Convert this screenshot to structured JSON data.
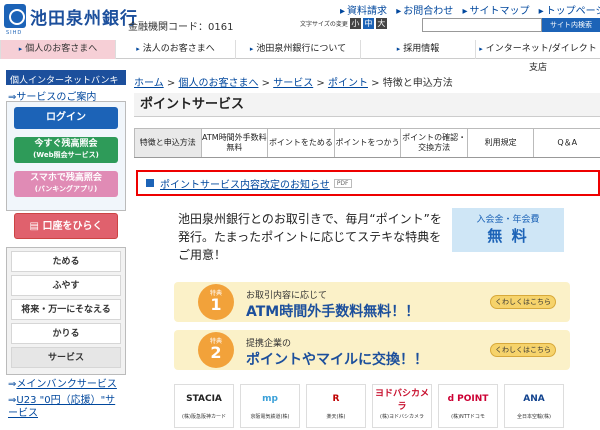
{
  "header": {
    "logo": "池田泉州銀行",
    "logo_sub": "SIHD",
    "bank_code": "金融機関コード：0161",
    "top_links": [
      "資料請求",
      "お問合わせ",
      "サイトマップ",
      "トップページ"
    ],
    "font_size_label": "文字サイズの変更",
    "font_sizes": [
      "小",
      "中",
      "大"
    ],
    "font_size_colors": [
      "#444444",
      "#1c63b7",
      "#444444"
    ],
    "search_placeholder": "",
    "search_button": "サイト内検索"
  },
  "gnav": [
    {
      "label": "個人のお客さまへ",
      "active": true
    },
    {
      "label": "法人のお客さまへ",
      "active": false
    },
    {
      "label": "池田泉州銀行について",
      "active": false
    },
    {
      "label": "採用情報",
      "active": false
    },
    {
      "label": "インターネット/ダイレクト支店",
      "active": false
    }
  ],
  "sidebar": {
    "head": "個人インターネットバンキング",
    "guide_link": "サービスのご案内",
    "login": "ログイン",
    "balance_l1": "今すぐ残高照会",
    "balance_l2": "(Web照会サービス)",
    "app_l1": "スマホで残高照会",
    "app_l2": "(バンキングアプリ)",
    "open_account": "口座をひらく",
    "menu": [
      "ためる",
      "ふやす",
      "将来・万一にそなえる",
      "かりる",
      "サービス"
    ],
    "sub_links": [
      "メインバンクサービス",
      "U23 \"0円（応援）\"サービス"
    ]
  },
  "breadcrumb": [
    "ホーム",
    "個人のお客さまへ",
    "サービス",
    "ポイント",
    "特徴と申込方法"
  ],
  "page_title": "ポイントサービス",
  "tabs": [
    "特徴と申込方法",
    "ATM時間外手数料無料",
    "ポイントをためる",
    "ポイントをつかう",
    "ポイントの確認・交換方法",
    "利用規定",
    "Q＆A"
  ],
  "notice": {
    "text": "ポイントサービス内容改定のお知らせ",
    "badge": "PDF"
  },
  "intro": "池田泉州銀行とのお取引きで、毎月“ポイント”を発行。たまったポイントに応じてステキな特典をご用意！",
  "free_badge": {
    "line1": "入会金・年会費",
    "line2": "無 料"
  },
  "benefits": [
    {
      "tag": "特典",
      "num": "1",
      "line1": "お取引内容に応じて",
      "line2": "ATM時間外手数料無料！！",
      "more": "くわしくはこちら"
    },
    {
      "tag": "特典",
      "num": "2",
      "line1": "提携企業の",
      "line2": "ポイントやマイルに交換！！",
      "more": "くわしくはこちら"
    }
  ],
  "partners": [
    {
      "logo": "STACIA",
      "caption": "(株)阪急阪神カード",
      "color": "#222222"
    },
    {
      "logo": "mp",
      "caption": "京阪電気鉄道(株)",
      "color": "#3aa0d8"
    },
    {
      "logo": "R",
      "caption": "楽天(株)",
      "color": "#bf0000"
    },
    {
      "logo": "ヨドバシカメラ",
      "caption": "(株)ヨドバシカメラ",
      "color": "#c8102e"
    },
    {
      "logo": "d POINT",
      "caption": "(株)NTTドコモ",
      "color": "#cc0033"
    },
    {
      "logo": "ANA",
      "caption": "全日本空輸(株)",
      "color": "#13448f"
    }
  ]
}
